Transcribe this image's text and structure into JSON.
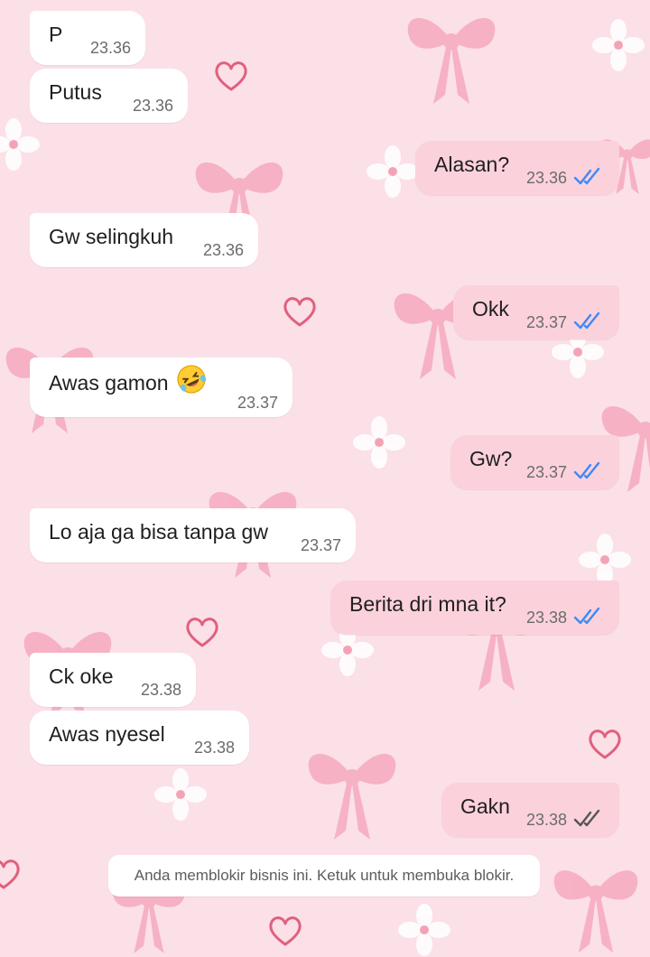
{
  "chat": {
    "messages": [
      {
        "direction": "in",
        "text": "P",
        "time": "23.36"
      },
      {
        "direction": "in",
        "text": "Putus",
        "time": "23.36"
      },
      {
        "direction": "out",
        "text": "Alasan?",
        "time": "23.36",
        "status": "read"
      },
      {
        "direction": "in",
        "text": "Gw selingkuh",
        "time": "23.36"
      },
      {
        "direction": "out",
        "text": "Okk",
        "time": "23.37",
        "status": "read"
      },
      {
        "direction": "in",
        "text": "Awas gamon",
        "time": "23.37",
        "emoji": "rolling-on-floor-laughing"
      },
      {
        "direction": "out",
        "text": "Gw?",
        "time": "23.37",
        "status": "read"
      },
      {
        "direction": "in",
        "text": "Lo aja ga bisa tanpa gw",
        "time": "23.37"
      },
      {
        "direction": "out",
        "text": "Berita dri mna it?",
        "time": "23.38",
        "status": "read"
      },
      {
        "direction": "in",
        "text": "Ck oke",
        "time": "23.38"
      },
      {
        "direction": "in",
        "text": "Awas nyesel",
        "time": "23.38"
      },
      {
        "direction": "out",
        "text": "Gakn",
        "time": "23.38",
        "status": "delivered"
      }
    ],
    "system_notice": "Anda memblokir bisnis ini. Ketuk untuk membuka blokir."
  },
  "colors": {
    "background": "#fbe0e7",
    "incoming_bubble": "#ffffff",
    "outgoing_bubble": "#fbd1dc",
    "read_ticks": "#3d8af7",
    "delivered_ticks": "#555555",
    "wallpaper_bow": "#f6a9bf",
    "wallpaper_heart": "#e0607e"
  }
}
